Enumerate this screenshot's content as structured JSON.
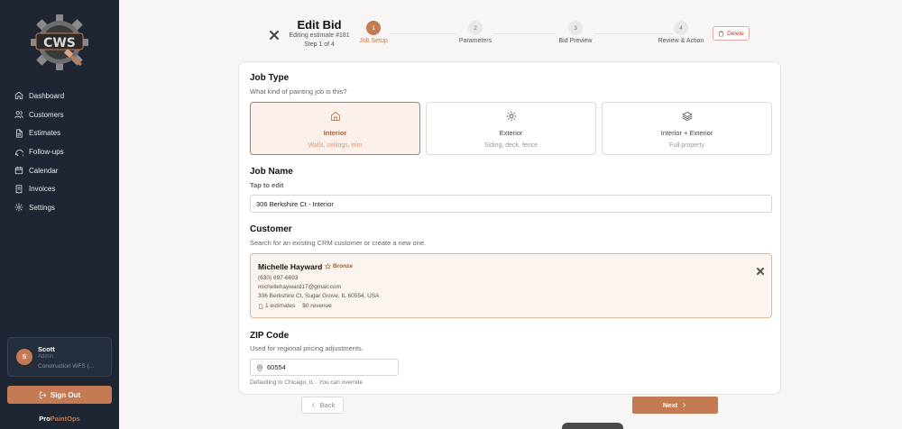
{
  "brand": {
    "logo_text": "CWS",
    "part1": "Pro",
    "part2": "PaintOps"
  },
  "nav": [
    {
      "label": "Dashboard",
      "icon": "home-icon"
    },
    {
      "label": "Customers",
      "icon": "users-icon"
    },
    {
      "label": "Estimates",
      "icon": "document-icon"
    },
    {
      "label": "Follow-ups",
      "icon": "chat-icon"
    },
    {
      "label": "Calendar",
      "icon": "calendar-icon"
    },
    {
      "label": "Invoices",
      "icon": "receipt-icon"
    },
    {
      "label": "Settings",
      "icon": "gear-icon"
    }
  ],
  "user": {
    "initial": "S",
    "name": "Scott",
    "role": "Admin",
    "org": "Construction WFS (..."
  },
  "signout_label": "Sign Out",
  "header": {
    "title": "Edit Bid",
    "subtitle": "Editing estimate #181",
    "step_text": "Step 1 of 4"
  },
  "steps": [
    {
      "num": "1",
      "label": "Job Setup"
    },
    {
      "num": "2",
      "label": "Parameters"
    },
    {
      "num": "3",
      "label": "Bid Preview"
    },
    {
      "num": "4",
      "label": "Review & Action"
    }
  ],
  "delete_label": "Delete",
  "job_type": {
    "title": "Job Type",
    "desc": "What kind of painting job is this?",
    "options": [
      {
        "name": "Interior",
        "desc": "Walls, ceilings, trim"
      },
      {
        "name": "Exterior",
        "desc": "Siding, deck, fence"
      },
      {
        "name": "Interior + Exterior",
        "desc": "Full property"
      }
    ]
  },
  "job_name": {
    "title": "Job Name",
    "hint": "Tap to edit",
    "value": "306 Berkshire Ct - Interior"
  },
  "customer": {
    "title": "Customer",
    "desc": "Search for an existing CRM customer or create a new one.",
    "name": "Michelle Hayward",
    "tier": "Bronze",
    "phone": "(630) 697-6693",
    "email": "michellehayward17@gmail.com",
    "address": "306 Berkshire Ct, Sugar Grove, IL 60554, USA",
    "estimates": "1 estimates",
    "revenue": "$0 revenue"
  },
  "zip": {
    "title": "ZIP Code",
    "desc": "Used for regional pricing adjustments.",
    "value": "60554",
    "note": "Defaulting to Chicago, IL · You can override"
  },
  "back_label": "Back",
  "next_label": "Next",
  "colors": {
    "accent": "#c47a52",
    "sidebar": "#1e2633"
  }
}
